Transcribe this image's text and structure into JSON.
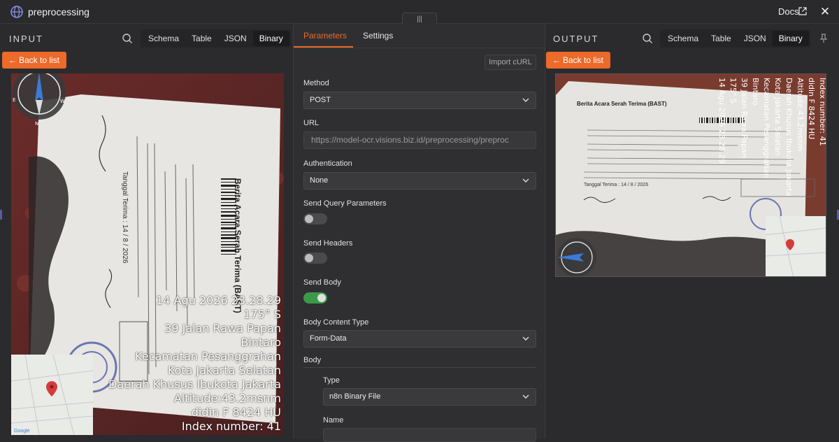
{
  "window": {
    "title": "preprocessing",
    "docs_label": "Docs",
    "close_glyph": "✕",
    "handle_glyph": "|||"
  },
  "input_pane": {
    "label": "INPUT",
    "tabs": [
      "Schema",
      "Table",
      "JSON",
      "Binary"
    ],
    "active_tab": "Binary",
    "back_label": "Back to list",
    "photo_overlay": [
      "14 Agu 2026 23.28.29",
      "175° S",
      "39 Jalan Rawa Papan",
      "Bintaro",
      "Kecamatan Pesanggrahan",
      "Kota Jakarta Selatan",
      "Daerah Khusus Ibukota Jakarta",
      "Altitude:43.2msnm",
      "didin F 8424 HU",
      "Index number: 41"
    ],
    "document_title": "Berita Acara Serah Terima (BAST)",
    "handwritten_date": "Tanggal Terima : 14 / 8 / 2026"
  },
  "parameters_pane": {
    "tabs": [
      "Parameters",
      "Settings"
    ],
    "active_tab": "Parameters",
    "import_label": "Import cURL",
    "method": {
      "label": "Method",
      "value": "POST"
    },
    "url": {
      "label": "URL",
      "value": "https://model-ocr.visions.biz.id/preprocessing/preproc"
    },
    "authentication": {
      "label": "Authentication",
      "value": "None"
    },
    "send_query": {
      "label": "Send Query Parameters",
      "on": false
    },
    "send_headers": {
      "label": "Send Headers",
      "on": false
    },
    "send_body": {
      "label": "Send Body",
      "on": true
    },
    "body_content_type": {
      "label": "Body Content Type",
      "value": "Form-Data"
    },
    "body": {
      "label": "Body"
    },
    "type": {
      "label": "Type",
      "value": "n8n Binary File"
    },
    "name": {
      "label": "Name"
    }
  },
  "output_pane": {
    "label": "OUTPUT",
    "tabs": [
      "Schema",
      "Table",
      "JSON",
      "Binary"
    ],
    "active_tab": "Binary",
    "back_label": "Back to list"
  },
  "colors": {
    "accent": "#ec6a2a",
    "toggle_on": "#3a9a4a"
  }
}
